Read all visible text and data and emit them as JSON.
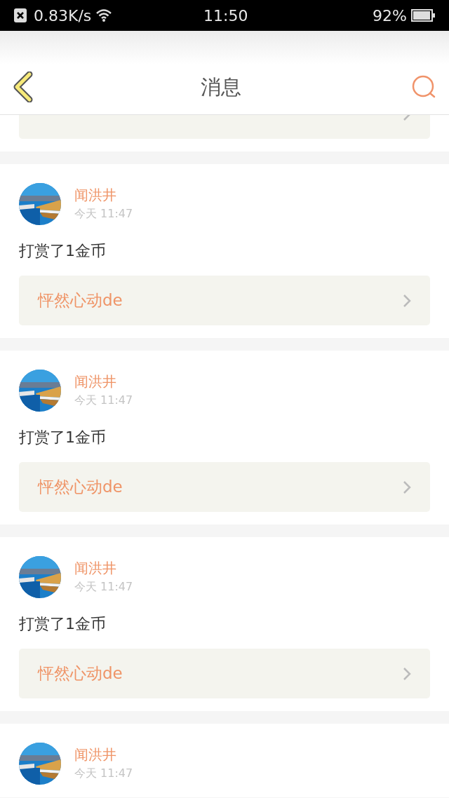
{
  "status_bar": {
    "network_speed": "0.83K/s",
    "time": "11:50",
    "battery": "92%"
  },
  "header": {
    "title": "消息"
  },
  "messages": [
    {
      "sender": "闻洪井",
      "time": "今天 11:47",
      "text": "打赏了1金币",
      "link": "怦然心动de"
    },
    {
      "sender": "闻洪井",
      "time": "今天 11:47",
      "text": "打赏了1金币",
      "link": "怦然心动de"
    },
    {
      "sender": "闻洪井",
      "time": "今天 11:47",
      "text": "打赏了1金币",
      "link": "怦然心动de"
    },
    {
      "sender": "闻洪井",
      "time": "今天 11:47"
    }
  ]
}
